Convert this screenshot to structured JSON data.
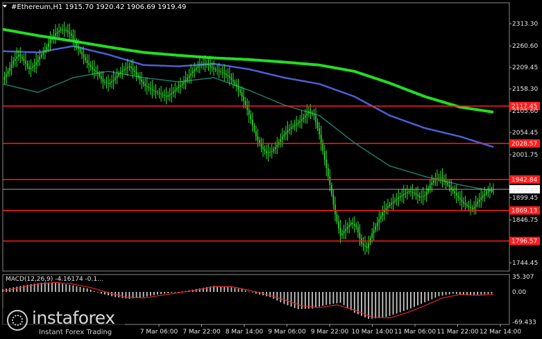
{
  "header": {
    "title": "#Ethereum,H1  1915.70 1920.42 1906.69 1919.49"
  },
  "watermark": {
    "name": "instaforex",
    "tagline": "Instant Forex Trading"
  },
  "colors": {
    "background": "#000000",
    "candle": "#32e632",
    "ma_fast": "#1f7a68",
    "ma_mid": "#4d5fd6",
    "ma_slow": "#22dd22",
    "level_line": "#ff1e1e",
    "macd_hist": "#c8c8c8",
    "macd_signal": "#e02828"
  },
  "chart_data": {
    "type": "candlestick",
    "symbol": "#Ethereum",
    "timeframe": "H1",
    "last_price": "1919.49",
    "ylim": [
      1725,
      2340
    ],
    "y_ticks": [
      "2313.30",
      "2260.60",
      "2209.45",
      "2158.30",
      "2105.60",
      "2054.45",
      "2001.75",
      "1899.45",
      "1846.75",
      "1744.45"
    ],
    "x_ticks": [
      "7 Mar 06:00",
      "7 Mar 22:00",
      "8 Mar 14:00",
      "9 Mar 06:00",
      "9 Mar 22:00",
      "10 Mar 14:00",
      "11 Mar 06:00",
      "11 Mar 22:00",
      "12 Mar 14:00"
    ],
    "levels": [
      {
        "label": "2117.45",
        "value": 2117.45
      },
      {
        "label": "2028.57",
        "value": 2028.57
      },
      {
        "label": "1942.84",
        "value": 1942.84
      },
      {
        "label": "1869.13",
        "value": 1869.13
      },
      {
        "label": "1796.57",
        "value": 1796.57
      }
    ],
    "close_path": [
      [
        0,
        2180
      ],
      [
        3,
        2200
      ],
      [
        6,
        2225
      ],
      [
        9,
        2240
      ],
      [
        12,
        2225
      ],
      [
        15,
        2205
      ],
      [
        18,
        2215
      ],
      [
        21,
        2235
      ],
      [
        24,
        2250
      ],
      [
        27,
        2275
      ],
      [
        30,
        2290
      ],
      [
        33,
        2300
      ],
      [
        36,
        2298
      ],
      [
        39,
        2285
      ],
      [
        42,
        2260
      ],
      [
        45,
        2240
      ],
      [
        48,
        2220
      ],
      [
        51,
        2205
      ],
      [
        54,
        2195
      ],
      [
        57,
        2175
      ],
      [
        60,
        2170
      ],
      [
        63,
        2180
      ],
      [
        66,
        2195
      ],
      [
        69,
        2205
      ],
      [
        72,
        2212
      ],
      [
        75,
        2198
      ],
      [
        78,
        2180
      ],
      [
        81,
        2165
      ],
      [
        84,
        2158
      ],
      [
        87,
        2150
      ],
      [
        90,
        2145
      ],
      [
        93,
        2140
      ],
      [
        96,
        2148
      ],
      [
        99,
        2160
      ],
      [
        102,
        2170
      ],
      [
        105,
        2185
      ],
      [
        108,
        2200
      ],
      [
        111,
        2212
      ],
      [
        114,
        2218
      ],
      [
        117,
        2215
      ],
      [
        120,
        2205
      ],
      [
        123,
        2200
      ],
      [
        126,
        2195
      ],
      [
        129,
        2185
      ],
      [
        132,
        2170
      ],
      [
        135,
        2150
      ],
      [
        138,
        2120
      ],
      [
        141,
        2085
      ],
      [
        144,
        2045
      ],
      [
        147,
        2020
      ],
      [
        150,
        2005
      ],
      [
        153,
        2010
      ],
      [
        156,
        2025
      ],
      [
        159,
        2045
      ],
      [
        162,
        2060
      ],
      [
        165,
        2070
      ],
      [
        168,
        2078
      ],
      [
        171,
        2090
      ],
      [
        174,
        2105
      ],
      [
        177,
        2095
      ],
      [
        180,
        2050
      ],
      [
        183,
        1990
      ],
      [
        186,
        1930
      ],
      [
        189,
        1860
      ],
      [
        192,
        1810
      ],
      [
        195,
        1825
      ],
      [
        198,
        1840
      ],
      [
        201,
        1830
      ],
      [
        204,
        1790
      ],
      [
        207,
        1780
      ],
      [
        210,
        1815
      ],
      [
        213,
        1840
      ],
      [
        216,
        1865
      ],
      [
        219,
        1880
      ],
      [
        222,
        1890
      ],
      [
        225,
        1900
      ],
      [
        228,
        1908
      ],
      [
        231,
        1915
      ],
      [
        234,
        1910
      ],
      [
        237,
        1900
      ],
      [
        240,
        1905
      ],
      [
        243,
        1930
      ],
      [
        246,
        1945
      ],
      [
        249,
        1948
      ],
      [
        252,
        1935
      ],
      [
        255,
        1920
      ],
      [
        258,
        1905
      ],
      [
        261,
        1890
      ],
      [
        264,
        1880
      ],
      [
        267,
        1872
      ],
      [
        270,
        1890
      ],
      [
        273,
        1905
      ],
      [
        276,
        1915
      ],
      [
        279,
        1920
      ]
    ],
    "ma_fast": [
      [
        0,
        2170
      ],
      [
        20,
        2150
      ],
      [
        40,
        2185
      ],
      [
        60,
        2200
      ],
      [
        80,
        2185
      ],
      [
        100,
        2175
      ],
      [
        120,
        2185
      ],
      [
        140,
        2155
      ],
      [
        160,
        2120
      ],
      [
        180,
        2095
      ],
      [
        200,
        2030
      ],
      [
        220,
        1975
      ],
      [
        240,
        1950
      ],
      [
        260,
        1930
      ],
      [
        279,
        1915
      ]
    ],
    "ma_mid": [
      [
        0,
        2248
      ],
      [
        20,
        2245
      ],
      [
        40,
        2260
      ],
      [
        60,
        2240
      ],
      [
        80,
        2215
      ],
      [
        100,
        2212
      ],
      [
        120,
        2218
      ],
      [
        140,
        2205
      ],
      [
        160,
        2185
      ],
      [
        180,
        2170
      ],
      [
        200,
        2140
      ],
      [
        220,
        2095
      ],
      [
        240,
        2065
      ],
      [
        260,
        2045
      ],
      [
        279,
        2020
      ]
    ],
    "ma_slow": [
      [
        0,
        2300
      ],
      [
        20,
        2285
      ],
      [
        40,
        2272
      ],
      [
        60,
        2258
      ],
      [
        80,
        2245
      ],
      [
        100,
        2238
      ],
      [
        120,
        2232
      ],
      [
        140,
        2228
      ],
      [
        160,
        2222
      ],
      [
        180,
        2215
      ],
      [
        200,
        2200
      ],
      [
        220,
        2172
      ],
      [
        240,
        2140
      ],
      [
        260,
        2115
      ],
      [
        279,
        2103
      ]
    ],
    "macd": {
      "label": "MACD(12,26,9) -4.16174 -0.1...",
      "ylim": [
        -75,
        40
      ],
      "y_ticks": [
        "35.307",
        "0.00",
        "-69.433"
      ],
      "hist": [
        [
          0,
          6
        ],
        [
          8,
          12
        ],
        [
          16,
          18
        ],
        [
          24,
          22
        ],
        [
          32,
          20
        ],
        [
          40,
          15
        ],
        [
          48,
          8
        ],
        [
          56,
          -4
        ],
        [
          64,
          -12
        ],
        [
          72,
          -16
        ],
        [
          80,
          -12
        ],
        [
          88,
          -6
        ],
        [
          96,
          -2
        ],
        [
          104,
          2
        ],
        [
          112,
          8
        ],
        [
          120,
          14
        ],
        [
          128,
          12
        ],
        [
          136,
          6
        ],
        [
          144,
          -4
        ],
        [
          152,
          -12
        ],
        [
          160,
          -28
        ],
        [
          168,
          -40
        ],
        [
          176,
          -38
        ],
        [
          184,
          -30
        ],
        [
          192,
          -25
        ],
        [
          200,
          -48
        ],
        [
          208,
          -62
        ],
        [
          216,
          -60
        ],
        [
          224,
          -50
        ],
        [
          232,
          -38
        ],
        [
          240,
          -24
        ],
        [
          248,
          -10
        ],
        [
          256,
          -4
        ],
        [
          264,
          -8
        ],
        [
          272,
          -6
        ],
        [
          279,
          -4
        ]
      ],
      "signal": [
        [
          0,
          2
        ],
        [
          10,
          10
        ],
        [
          20,
          18
        ],
        [
          30,
          22
        ],
        [
          40,
          18
        ],
        [
          50,
          10
        ],
        [
          60,
          -2
        ],
        [
          70,
          -12
        ],
        [
          80,
          -14
        ],
        [
          90,
          -8
        ],
        [
          100,
          -2
        ],
        [
          110,
          4
        ],
        [
          120,
          12
        ],
        [
          130,
          12
        ],
        [
          140,
          4
        ],
        [
          150,
          -6
        ],
        [
          160,
          -18
        ],
        [
          170,
          -32
        ],
        [
          180,
          -36
        ],
        [
          190,
          -30
        ],
        [
          200,
          -42
        ],
        [
          210,
          -58
        ],
        [
          220,
          -60
        ],
        [
          230,
          -48
        ],
        [
          240,
          -32
        ],
        [
          250,
          -14
        ],
        [
          260,
          -6
        ],
        [
          270,
          -8
        ],
        [
          279,
          -6
        ]
      ]
    }
  }
}
